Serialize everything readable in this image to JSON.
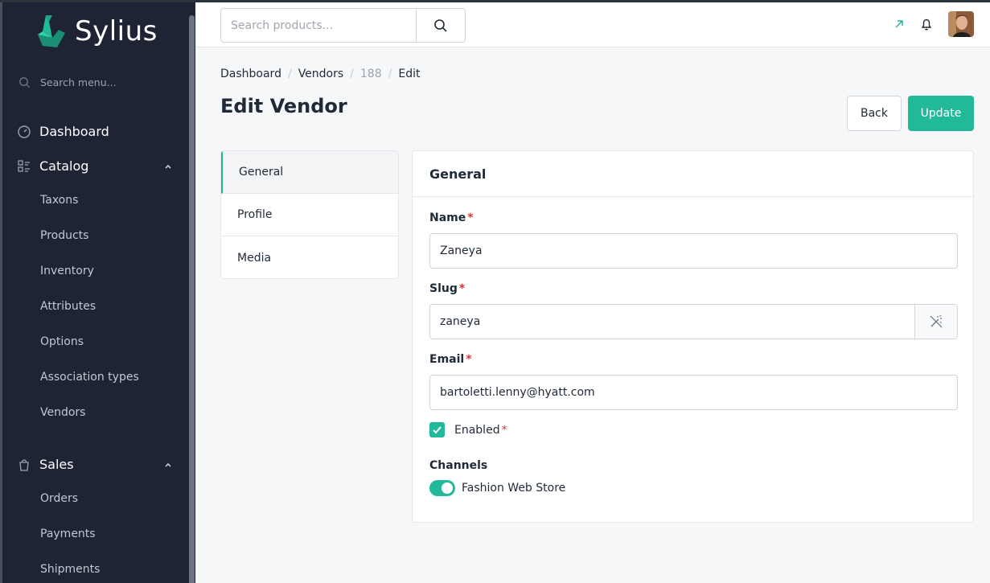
{
  "app": {
    "logo_text": "Sylius"
  },
  "sidebar": {
    "search_placeholder": "Search menu...",
    "dashboard": "Dashboard",
    "catalog": {
      "label": "Catalog",
      "items": [
        "Taxons",
        "Products",
        "Inventory",
        "Attributes",
        "Options",
        "Association types",
        "Vendors"
      ]
    },
    "sales": {
      "label": "Sales",
      "items": [
        "Orders",
        "Payments",
        "Shipments"
      ]
    }
  },
  "topbar": {
    "search_placeholder": "Search products...",
    "icons": [
      "search-icon",
      "external-link-icon",
      "bell-icon",
      "avatar"
    ]
  },
  "breadcrumb": [
    "Dashboard",
    "Vendors",
    "188",
    "Edit"
  ],
  "page_title": "Edit Vendor",
  "actions": {
    "back": "Back",
    "update": "Update"
  },
  "tabs": [
    "General",
    "Profile",
    "Media"
  ],
  "form": {
    "header": "General",
    "name": {
      "label": "Name",
      "required": "*",
      "value": "Zaneya"
    },
    "slug": {
      "label": "Slug",
      "required": "*",
      "value": "zaneya"
    },
    "email": {
      "label": "Email",
      "required": "*",
      "value": "bartoletti.lenny@hyatt.com"
    },
    "enabled": {
      "label": "Enabled",
      "required": "*",
      "checked": true
    },
    "channels": {
      "label": "Channels",
      "option": "Fashion Web Store",
      "on": true
    }
  },
  "colors": {
    "accent": "#22b99a",
    "sidebar_bg": "#1e2434",
    "required": "#d63939"
  }
}
